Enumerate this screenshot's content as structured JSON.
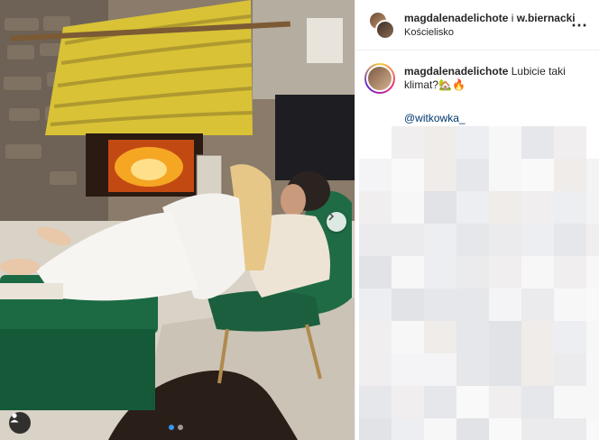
{
  "post": {
    "author": "magdalenadelichote",
    "joiner": " i ",
    "coauthor": "w.biernacki",
    "location": "Kościelisko",
    "more_icon": "⋯",
    "caption": {
      "author": "magdalenadelichote",
      "text": "Lubicie taki klimat?",
      "emoji": "🏡🔥",
      "mention": "@witkowka_"
    }
  },
  "carousel": {
    "slide_count": 2,
    "active_index": 0
  },
  "colors": {
    "accent": "#3897f0",
    "mention": "#00376b",
    "text": "#262626",
    "chair_green": "#1f6b46"
  }
}
